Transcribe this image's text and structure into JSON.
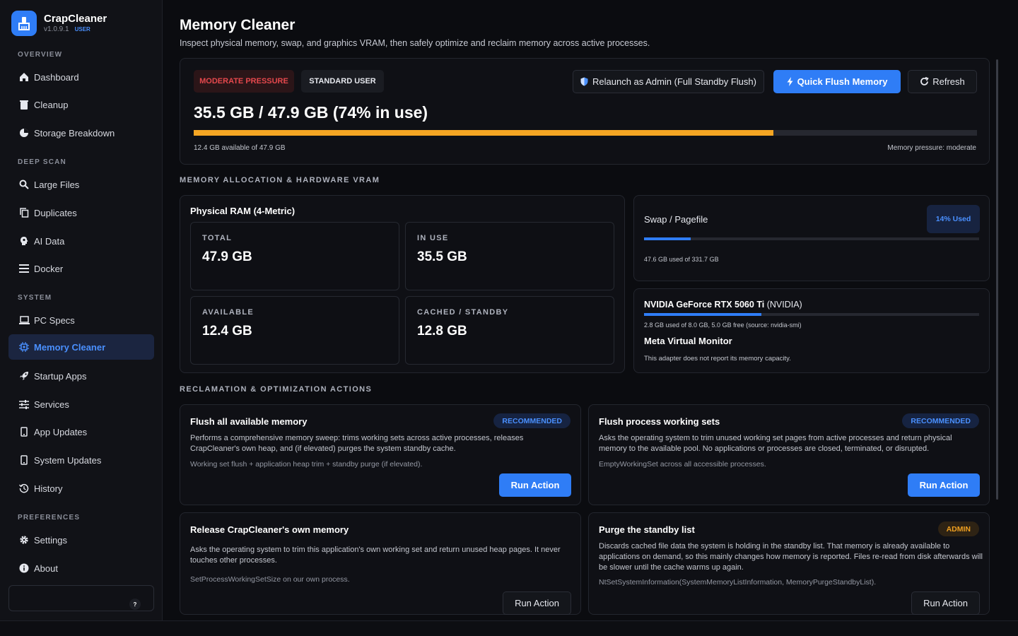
{
  "app": {
    "name": "CrapCleaner",
    "version": "v1.0.9.1",
    "role": "USER"
  },
  "sidebar": {
    "sections": [
      {
        "label": "OVERVIEW"
      },
      {
        "label": "DEEP SCAN"
      },
      {
        "label": "SYSTEM"
      },
      {
        "label": "PREFERENCES"
      }
    ],
    "items": [
      {
        "label": "Dashboard",
        "icon": "home-icon"
      },
      {
        "label": "Cleanup",
        "icon": "trash-icon"
      },
      {
        "label": "Storage Breakdown",
        "icon": "pie-icon"
      },
      {
        "label": "Large Files",
        "icon": "search-icon"
      },
      {
        "label": "Duplicates",
        "icon": "copy-icon"
      },
      {
        "label": "AI Data",
        "icon": "brain-icon"
      },
      {
        "label": "Docker",
        "icon": "list-icon"
      },
      {
        "label": "PC Specs",
        "icon": "laptop-icon"
      },
      {
        "label": "Memory Cleaner",
        "icon": "chip-icon",
        "active": true
      },
      {
        "label": "Startup Apps",
        "icon": "rocket-icon"
      },
      {
        "label": "Services",
        "icon": "sliders-icon"
      },
      {
        "label": "App Updates",
        "icon": "phone-icon"
      },
      {
        "label": "System Updates",
        "icon": "phone-icon"
      },
      {
        "label": "History",
        "icon": "history-icon"
      },
      {
        "label": "Settings",
        "icon": "gear-icon"
      },
      {
        "label": "About",
        "icon": "info-icon"
      }
    ],
    "help_label": "?"
  },
  "page": {
    "title": "Memory Cleaner",
    "subtitle": "Inspect physical memory, swap, and graphics VRAM, then safely optimize and reclaim memory across active processes."
  },
  "overview": {
    "pressure_badge": "MODERATE PRESSURE",
    "user_badge": "STANDARD USER",
    "relaunch_label": "Relaunch as Admin (Full Standby Flush)",
    "quick_flush_label": "Quick Flush Memory",
    "refresh_label": "Refresh",
    "headline": "35.5 GB / 47.9 GB (74% in use)",
    "usage_fraction": 0.74,
    "available_text": "12.4 GB available of 47.9 GB",
    "pressure_text": "Memory pressure: moderate"
  },
  "allocation": {
    "heading": "MEMORY ALLOCATION & HARDWARE VRAM",
    "physical_title": "Physical RAM (4-Metric)",
    "metrics": [
      {
        "label": "TOTAL",
        "value": "47.9 GB"
      },
      {
        "label": "IN USE",
        "value": "35.5 GB"
      },
      {
        "label": "AVAILABLE",
        "value": "12.4 GB"
      },
      {
        "label": "CACHED / STANDBY",
        "value": "12.8 GB"
      }
    ],
    "swap": {
      "title": "Swap / Pagefile",
      "badge": "14% Used",
      "fraction": 0.14,
      "detail": "47.6 GB used of 331.7 GB"
    },
    "gpu": {
      "name": "NVIDIA GeForce RTX 5060 Ti",
      "vendor": "(NVIDIA)",
      "fraction": 0.35,
      "detail": "2.8 GB used of 8.0 GB, 5.0 GB free (source: nvidia-smi)",
      "monitor_name": "Meta Virtual Monitor",
      "monitor_detail": "This adapter does not report its memory capacity."
    }
  },
  "actions": {
    "heading": "RECLAMATION & OPTIMIZATION ACTIONS",
    "items": [
      {
        "title": "Flush all available memory",
        "tag": "RECOMMENDED",
        "desc": "Performs a comprehensive memory sweep: trims working sets across active processes, releases CrapCleaner's own heap, and (if elevated) purges the system standby cache.",
        "note": "Working set flush + application heap trim + standby purge (if elevated).",
        "button": "Run Action"
      },
      {
        "title": "Flush process working sets",
        "tag": "RECOMMENDED",
        "desc": "Asks the operating system to trim unused working set pages from active processes and return physical memory to the available pool. No applications or processes are closed, terminated, or disrupted.",
        "note": "EmptyWorkingSet across all accessible processes.",
        "button": "Run Action"
      },
      {
        "title": "Release CrapCleaner's own memory",
        "tag": "",
        "desc": "Asks the operating system to trim this application's own working set and return unused heap pages. It never touches other processes.",
        "note": "SetProcessWorkingSetSize on our own process.",
        "button": "Run Action"
      },
      {
        "title": "Purge the standby list",
        "tag": "ADMIN",
        "desc": "Discards cached file data the system is holding in the standby list. That memory is already available to applications on demand, so this mainly changes how memory is reported. Files re-read from disk afterwards will be slower until the cache warms up again.",
        "note": "NtSetSystemInformation(SystemMemoryListInformation, MemoryPurgeStandbyList).",
        "button": "Run Action"
      }
    ]
  },
  "colors": {
    "accent": "#2f7df6",
    "bar": "#f5a623",
    "danger": "#e5484d",
    "warning": "#f0a020"
  }
}
